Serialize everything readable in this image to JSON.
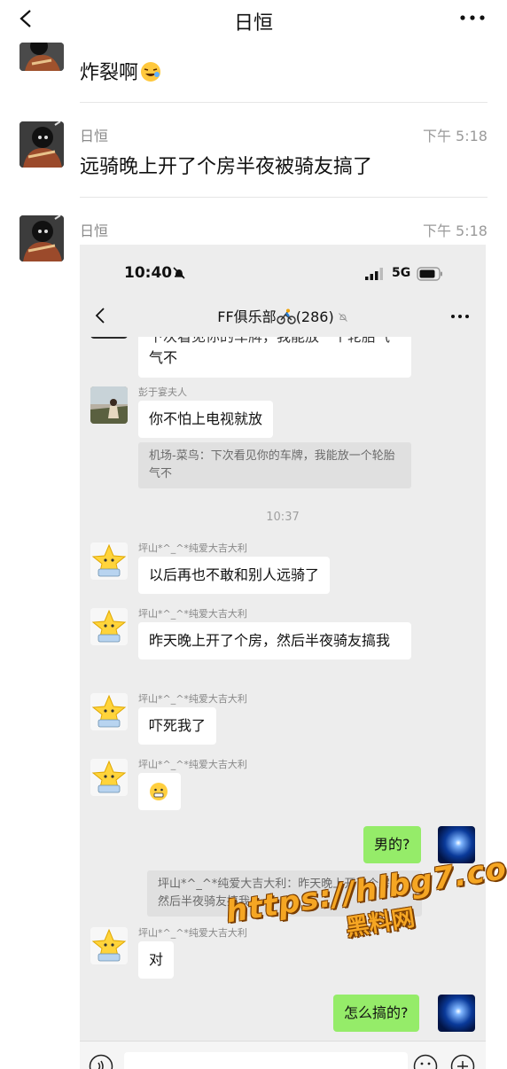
{
  "header": {
    "title": "日恒"
  },
  "messages": [
    {
      "text": "炸裂啊"
    },
    {
      "sender": "日恒",
      "time": "下午 5:18",
      "text": "远骑晚上开了个房半夜被骑友搞了"
    },
    {
      "sender": "日恒",
      "time": "下午 5:18"
    }
  ],
  "embedded": {
    "status": {
      "clock": "10:40",
      "network": "5G"
    },
    "nav": {
      "title": "FF俱乐部",
      "count": "(286)"
    },
    "chat": {
      "clipped_text": "下次看见你的车牌，我能放一个轮胎气不",
      "clipped_tail": "气不",
      "m1_name": "彭于宴夫人",
      "m1_text": "你不怕上电视就放",
      "m1_quote": "机场-菜鸟：下次看见你的车牌，我能放一个轮胎气不",
      "timestamp": "10:37",
      "star_name": "坪山*^_^*纯爱大吉大利",
      "m2_text": "以后再也不敢和别人远骑了",
      "m3_text": "昨天晚上开了个房，然后半夜骑友搞我",
      "m4_text": "吓死我了",
      "self1_text": "男的?",
      "quote2": "坪山*^_^*纯爱大吉大利：昨天晚上开了个房，然后半夜骑友搞我",
      "m6_text": "对",
      "self2_text": "怎么搞的?"
    }
  },
  "watermark": {
    "url": "https://hlbg7.com",
    "name": "黑料网"
  },
  "colors": {
    "self_bubble": "#95ec69",
    "chat_bg": "#ededed",
    "watermark": "#f5a623"
  }
}
